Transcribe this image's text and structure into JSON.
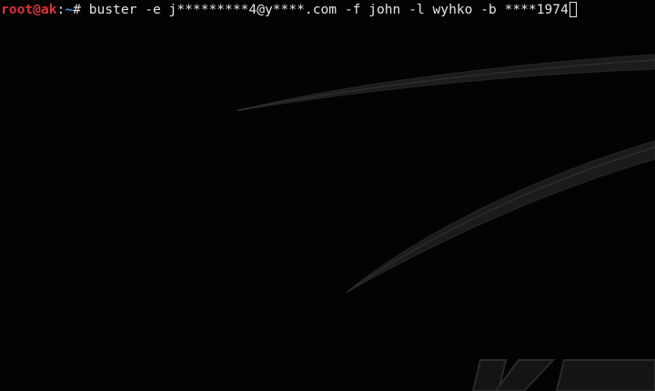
{
  "terminal": {
    "prompt": {
      "user_host": "root@ak",
      "colon": ":",
      "cwd": "~",
      "symbol": "# "
    },
    "command": "buster -e j*********4@y****.com -f john -l wyhko -b ****1974"
  },
  "colors": {
    "background": "#030303",
    "prompt_user": "#e0303a",
    "prompt_path": "#3f8ff0",
    "text": "#e6e6e6"
  },
  "icons": {
    "wallpaper": "kali-dragon-logo-watermark",
    "cursor": "block-cursor"
  }
}
